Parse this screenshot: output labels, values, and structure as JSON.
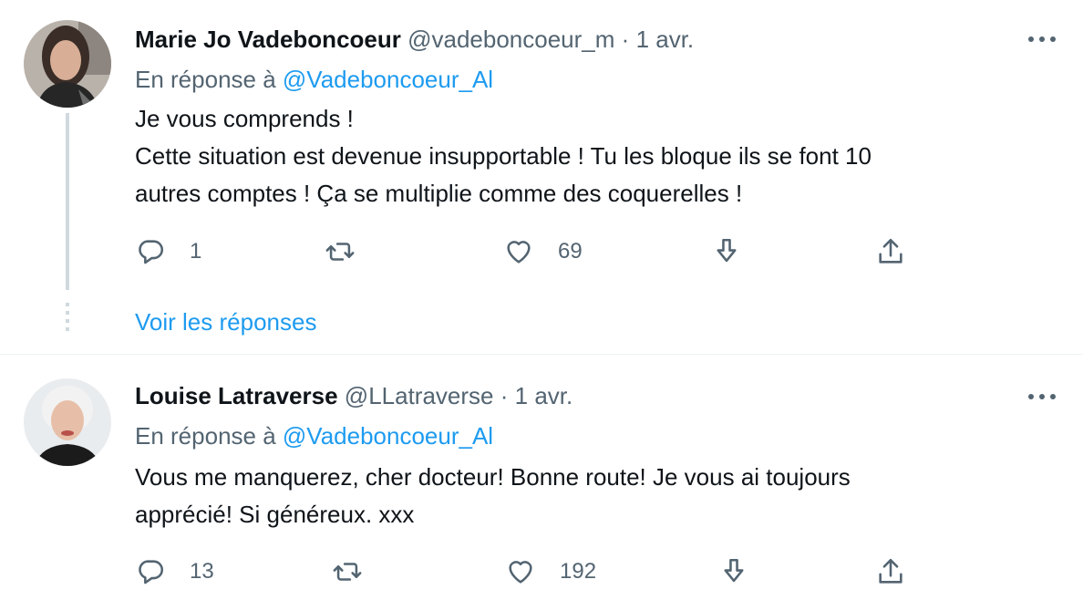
{
  "tweets": [
    {
      "name": "Marie Jo Vadeboncoeur",
      "handle": "@vadeboncoeur_m",
      "separator": "·",
      "date": "1 avr.",
      "reply_prefix": "En réponse à",
      "reply_mention": "@Vadeboncoeur_Al",
      "text_lines": [
        "Je vous comprends !",
        "Cette situation est devenue insupportable !  Tu les bloque ils se font 10",
        "autres comptes ! Ça se multiplie comme des coquerelles !"
      ],
      "reply_count": "1",
      "retweet_count": "",
      "like_count": "69"
    },
    {
      "name": "Louise Latraverse",
      "handle": "@LLatraverse",
      "separator": "·",
      "date": "1 avr.",
      "reply_prefix": "En réponse à",
      "reply_mention": "@Vadeboncoeur_Al",
      "text_lines": [
        "Vous me manquerez, cher docteur! Bonne route! Je vous ai toujours",
        "apprécié! Si généreux. xxx"
      ],
      "reply_count": "13",
      "retweet_count": "",
      "like_count": "192"
    }
  ],
  "show_replies_label": "Voir les réponses",
  "icons": {
    "reply": "reply-icon",
    "retweet": "retweet-icon",
    "like": "heart-icon",
    "download": "download-icon",
    "share": "share-icon",
    "more": "more-icon"
  },
  "colors": {
    "link": "#1d9bf0",
    "secondary_text": "#536471",
    "primary_text": "#0f1419",
    "thread_line": "#cfd9de"
  }
}
